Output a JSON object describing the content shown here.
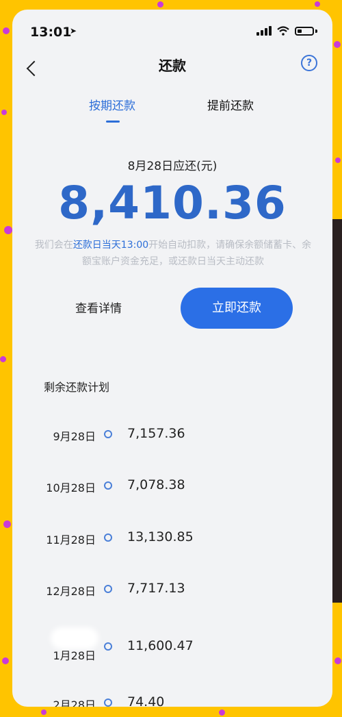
{
  "status_bar": {
    "time": "13:01"
  },
  "nav": {
    "title": "还款"
  },
  "tabs": [
    {
      "label": "按期还款",
      "active": true
    },
    {
      "label": "提前还款",
      "active": false
    }
  ],
  "due": {
    "label": "8月28日应还(元)",
    "amount": "8,410.36",
    "notice_prefix": "我们会在",
    "notice_highlight": "还款日当天13:00",
    "notice_suffix": "开始自动扣款，请确保余额储蓄卡、余额宝账户资金充足，或还款日当天主动还款"
  },
  "actions": {
    "detail_label": "查看详情",
    "pay_label": "立即还款"
  },
  "plan": {
    "title": "剩余还款计划",
    "rows": [
      {
        "date": "9月28日",
        "amount": "7,157.36"
      },
      {
        "date": "10月28日",
        "amount": "7,078.38"
      },
      {
        "date": "11月28日",
        "amount": "13,130.85"
      },
      {
        "date": "12月28日",
        "amount": "7,717.13"
      },
      {
        "date": "1月28日",
        "amount": "11,600.47"
      },
      {
        "date": "2月28日",
        "amount": "74.40"
      }
    ]
  },
  "colors": {
    "accent": "#2c6ed8",
    "amount": "#2e68c8",
    "background": "#ffc400"
  }
}
